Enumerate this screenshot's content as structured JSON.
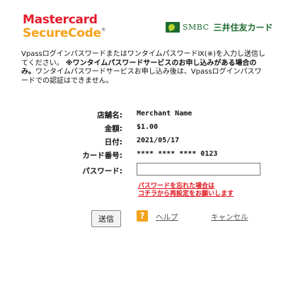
{
  "brand": {
    "mastercard_line1": "Mastercard",
    "mastercard_line2": "SecureCode",
    "mastercard_mark": "®",
    "smbc_abbrev": "SMBC",
    "smbc_card": "三井住友カード"
  },
  "intro": {
    "line1": "VpassログインパスワードまたはワンタイムパスワードⅨ(※)を入力し送信してください。",
    "bold": "※ワンタイムパスワードサービスのお申し込みがある場合のみ。",
    "rest": "ワンタイムパスワードサービスお申し込み後は、Vpassログインパスワードでの認証はできません。"
  },
  "fields": {
    "merchant_label": "店舗名:",
    "merchant_value": "Merchant Name",
    "amount_label": "金額:",
    "amount_value": "$1.00",
    "date_label": "日付:",
    "date_value": "2021/05/17",
    "card_label": "カード番号:",
    "card_value": "**** **** **** 0123",
    "password_label": "パスワード:",
    "password_value": ""
  },
  "forgot": {
    "line1": "パスワードを忘れた場合は",
    "line2": "コチラから再設定をお願いします"
  },
  "actions": {
    "submit": "送信",
    "help_icon": "?",
    "help": "ヘルプ",
    "cancel": "キャンセル"
  },
  "colors": {
    "mastercard_red": "#e41c2c",
    "mastercard_orange": "#f5a21b",
    "smbc_green": "#1d6b30",
    "alert_red": "#e0141c"
  }
}
